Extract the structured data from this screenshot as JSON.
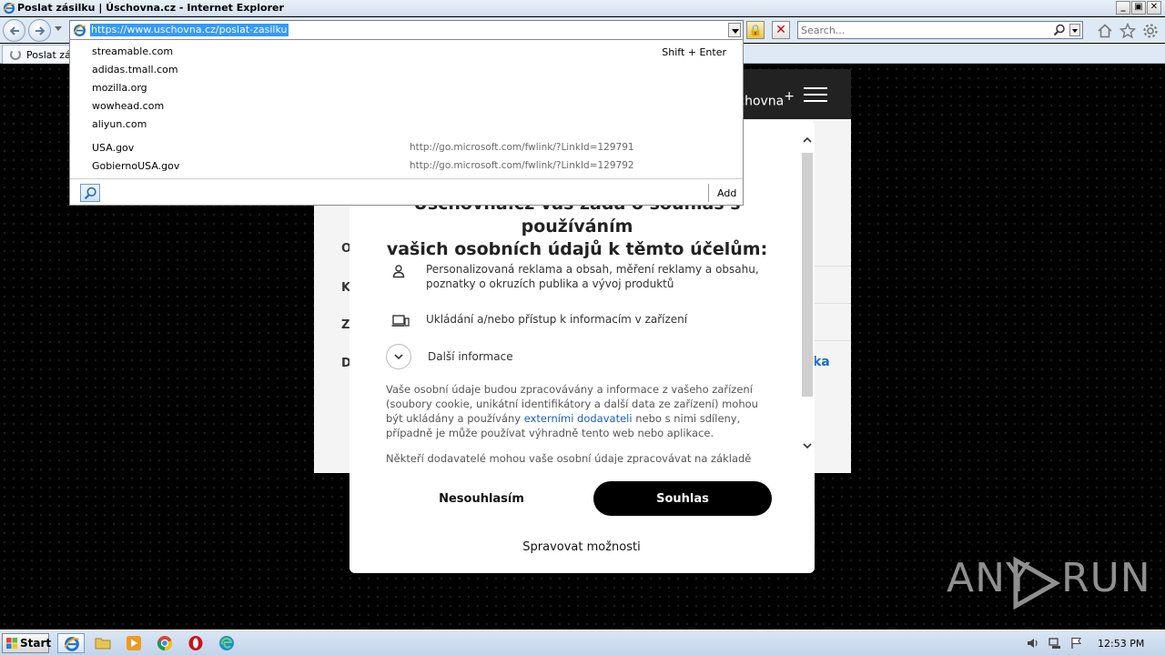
{
  "window": {
    "title": "Poslat zásilku | Úschovna.cz - Internet Explorer",
    "buttons": {
      "minimize": "_",
      "maximize": "▣",
      "close": "✕"
    }
  },
  "navbar": {
    "url": "https://www.uschovna.cz/poslat-zasilku",
    "search_placeholder": "Search..."
  },
  "tab": {
    "label": "Poslat zás"
  },
  "autocomplete": {
    "shortcut": "Shift + Enter",
    "history": [
      "streamable.com",
      "adidas.tmall.com",
      "mozilla.org",
      "wowhead.com",
      "aliyun.com"
    ],
    "favorites": [
      {
        "name": "USA.gov",
        "url": "http://go.microsoft.com/fwlink/?LinkId=129791"
      },
      {
        "name": "GobiernoUSA.gov",
        "url": "http://go.microsoft.com/fwlink/?LinkId=129792"
      }
    ],
    "add_label": "Add"
  },
  "site": {
    "brand": "schovna",
    "brand_sup": "+",
    "letters": [
      "O",
      "K",
      "Z",
      "D"
    ],
    "link": "ka"
  },
  "consent": {
    "heading_line1": "Úschovna.cz vás žádá o souhlas s používáním",
    "heading_line2": "vašich osobních údajů k těmto účelům:",
    "purposes": [
      {
        "icon": "person-icon",
        "text": "Personalizovaná reklama a obsah, měření reklamy a obsahu, poznatky o okruzích publika a vývoj produktů"
      },
      {
        "icon": "devices-icon",
        "text": "Ukládání a/nebo přístup k informacím v zařízení"
      }
    ],
    "more_info": "Další informace",
    "description_before": "Vaše osobní údaje budou zpracovávány a informace z vašeho zařízení (soubory cookie, unikátní identifikátory a další data ze zařízení) mohou být ukládány a používány ",
    "description_link": "externími dodavateli",
    "description_after": " nebo s nimi sdíleny, případně je může používat výhradně tento web nebo aplikace.",
    "description2": "Někteří dodavatelé mohou vaše osobní údaje zpracovávat na základě",
    "decline_label": "Nesouhlasím",
    "accept_label": "Souhlas",
    "manage_label": "Spravovat možnosti"
  },
  "watermark": {
    "left": "ANY",
    "right": "RUN"
  },
  "taskbar": {
    "start_label": "Start",
    "clock": "12:53 PM"
  }
}
